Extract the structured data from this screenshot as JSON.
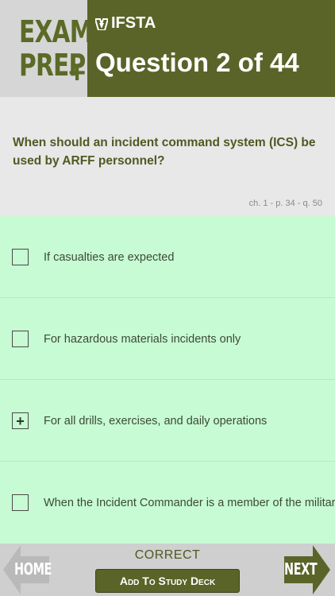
{
  "header": {
    "brand_line1": "EXAM",
    "brand_line2": "PREP",
    "brand_plus": "+",
    "logo_text": "IFSTA",
    "question_title": "Question 2 of 44"
  },
  "question": {
    "text": "When should an incident command system (ICS) be used by ARFF personnel?",
    "reference": "ch. 1 - p. 34 - q. 50"
  },
  "answers": [
    {
      "label": "If casualties are expected",
      "mark": ""
    },
    {
      "label": "For hazardous materials incidents only",
      "mark": ""
    },
    {
      "label": "For all drills, exercises, and daily operations",
      "mark": "+"
    },
    {
      "label": "When the Incident Commander is a member of the military",
      "mark": ""
    }
  ],
  "footer": {
    "home_label": "HOME",
    "next_label": "NEXT",
    "result": "CORRECT",
    "study_deck_label": "Add To Study Deck"
  },
  "colors": {
    "brand_green": "#5b6428",
    "answers_bg": "#c7fbd3",
    "text_green": "#4e5a22"
  }
}
